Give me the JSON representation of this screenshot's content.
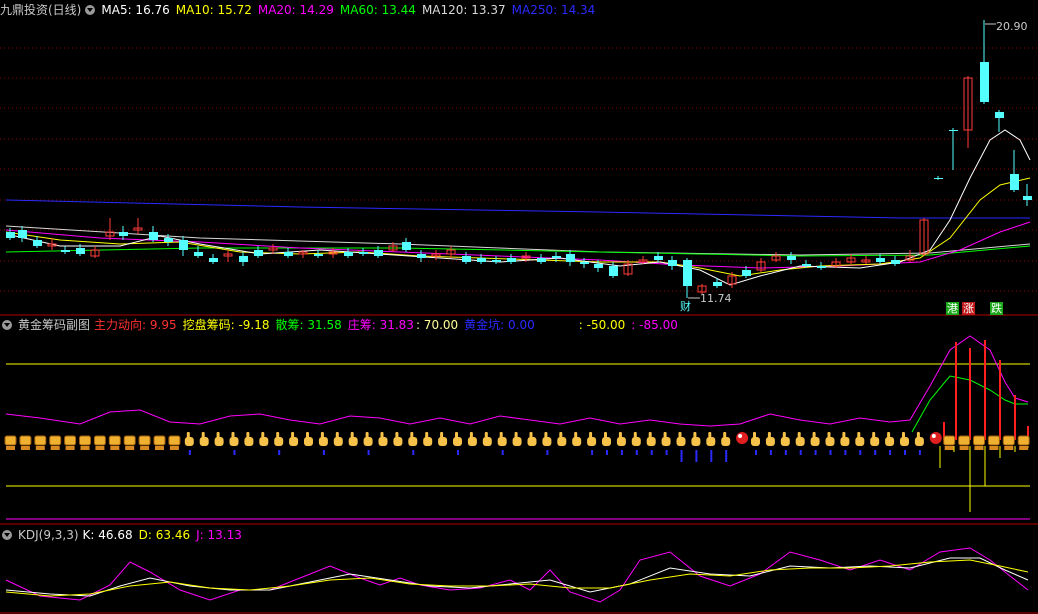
{
  "colors": {
    "background": "#000000",
    "grid": "#8b0000",
    "up": "#ff3c3c",
    "down": "#54ffff",
    "ma5": "#ffffff",
    "ma10": "#ffff00",
    "ma20": "#ff00ff",
    "ma60": "#00ff00",
    "ma120": "#d8d8d8",
    "ma250": "#2a2aff"
  },
  "main": {
    "title": "九鼎投资(日线)",
    "ma5": "MA5: 16.76",
    "ma10": "MA10: 15.72",
    "ma20": "MA20: 14.29",
    "ma60": "MA60: 13.44",
    "ma120": "MA120: 13.37",
    "ma250": "MA250: 14.34",
    "high_label": "20.90",
    "low_label": "11.74",
    "badge_cai": "财",
    "badge_gang": "港",
    "badge_zhang": "涨",
    "badge_die": "跌"
  },
  "sub": {
    "title": "黄金筹码副图",
    "zhuli": "主力动向: 9.95",
    "wapan": "挖盘筹码: -9.18",
    "sanchou": "散筹: 31.58",
    "zhuangchou": "庄筹: 31.83",
    "v70": ": 70.00",
    "huangjinkeng": "黄金坑: 0.00",
    "vm50": ": -50.00",
    "vm85": ": -85.00",
    "icon_hand": "hand-pointer-icon",
    "icon_money": "money-bag-icon",
    "icon_ball": "red-ball-icon"
  },
  "kdj": {
    "title": "KDJ(9,3,3)",
    "k": "K: 46.68",
    "d": "D: 63.46",
    "j": "J: 13.13"
  }
}
